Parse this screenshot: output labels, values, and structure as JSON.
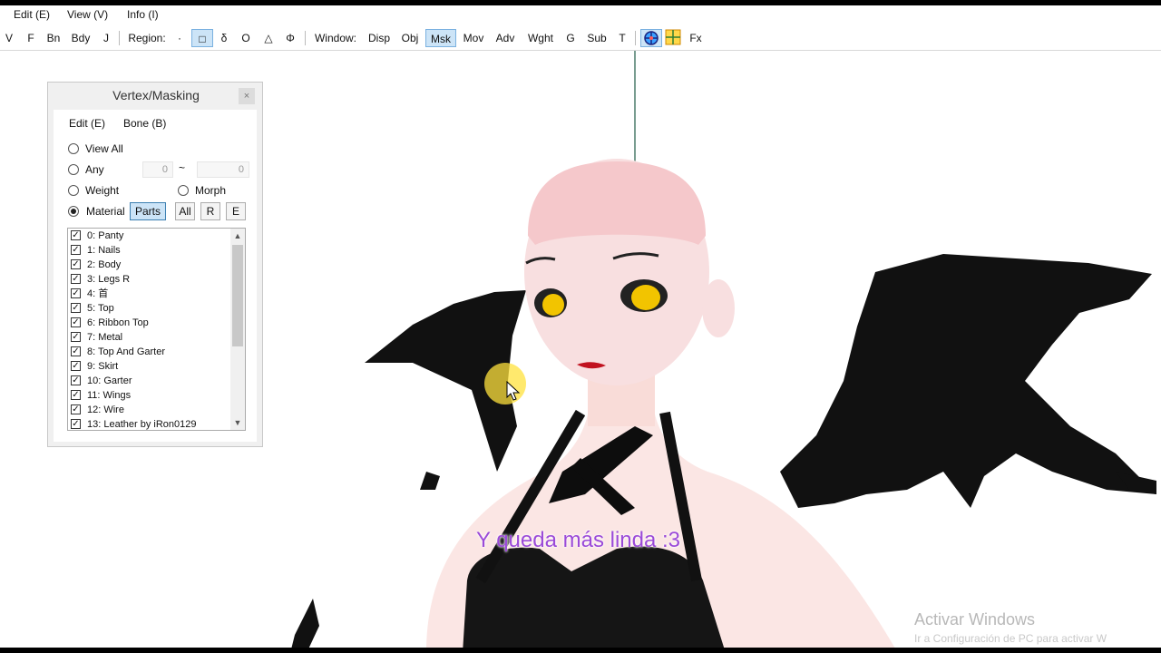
{
  "menu": {
    "edit": "Edit (E)",
    "view": "View (V)",
    "info": "Info (I)"
  },
  "toolbar": {
    "v": "V",
    "f": "F",
    "bn": "Bn",
    "bdy": "Bdy",
    "j": "J",
    "region_label": "Region:",
    "dot": "·",
    "square": "□",
    "delta": "δ",
    "circle": "O",
    "triangle": "△",
    "phi": "Φ",
    "window_label": "Window:",
    "disp": "Disp",
    "obj": "Obj",
    "msk": "Msk",
    "mov": "Mov",
    "adv": "Adv",
    "wght": "Wght",
    "g": "G",
    "sub": "Sub",
    "t": "T",
    "fx": "Fx"
  },
  "panel": {
    "title": "Vertex/Masking",
    "close": "×",
    "menu_edit": "Edit (E)",
    "menu_bone": "Bone (B)",
    "view_all": "View All",
    "any": "Any",
    "any_from": "0",
    "tilde": "~",
    "any_to": "0",
    "weight": "Weight",
    "morph": "Morph",
    "material": "Material",
    "parts": "Parts",
    "all": "All",
    "r": "R",
    "e": "E",
    "materials": [
      "0: Panty",
      "1: Nails",
      "2: Body",
      "3: Legs R",
      "4: 首",
      "5: Top",
      "6: Ribbon Top",
      "7: Metal",
      "8: Top And Garter",
      "9: Skirt",
      "10: Garter",
      "11: Wings",
      "12: Wire",
      "13: Leather by iRon0129"
    ]
  },
  "subtitle": "Y queda más linda :3",
  "watermark": {
    "line1": "Activar Windows",
    "line2": "Ir a Configuración de PC para activar W"
  }
}
